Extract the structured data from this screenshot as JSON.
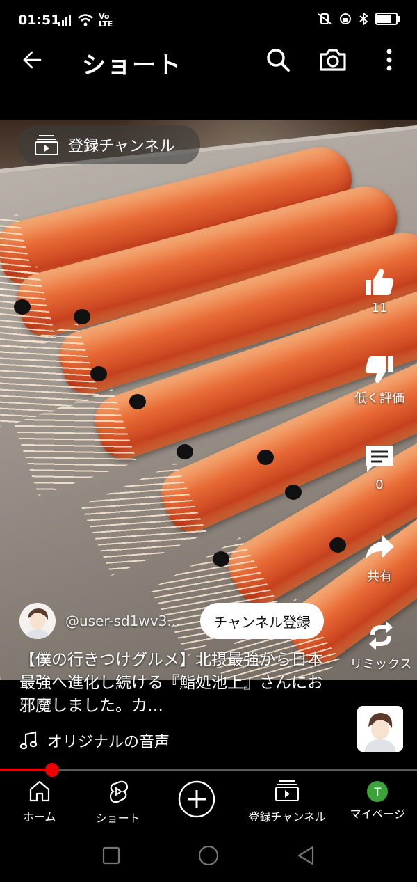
{
  "status_bar": {
    "time": "01:51",
    "network": "Vo LTE"
  },
  "header": {
    "title": "ショート"
  },
  "video": {
    "channel_pill_label": "登録チャンネル"
  },
  "actions": {
    "like_count": "11",
    "dislike_label": "低く評価",
    "comment_count": "0",
    "share_label": "共有",
    "remix_label": "リミックス"
  },
  "channel": {
    "handle": "@user-sd1wv3...",
    "subscribe_label": "チャンネル登録"
  },
  "description": "【僕の行きつけグルメ】北摂最強から日本最強へ進化し続ける『鮨処池上』さんにお邪魔しました。カ…",
  "audio": {
    "label": "オリジナルの音声"
  },
  "progress": {
    "played_fraction": 0.125
  },
  "bottom_nav": {
    "home": "ホーム",
    "shorts": "ショート",
    "subscriptions": "登録チャンネル",
    "mypage": "マイページ",
    "avatar_letter": "T"
  },
  "colors": {
    "accent": "#ff0000",
    "avatar_green": "#3aa33a"
  }
}
